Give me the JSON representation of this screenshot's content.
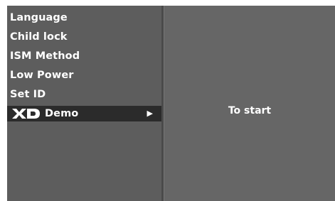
{
  "menu": {
    "items": [
      {
        "label": "Language"
      },
      {
        "label": "Child lock"
      },
      {
        "label": "ISM Method"
      },
      {
        "label": "Low Power"
      },
      {
        "label": "Set ID"
      }
    ],
    "selected": {
      "logo_text": "XD",
      "label": "Demo",
      "arrow": "▶",
      "icon": "xd-logo-icon"
    }
  },
  "detail": {
    "action_label": "To start"
  },
  "colors": {
    "panel_bg": "#5d5d5d",
    "right_bg": "#666666",
    "selected_bg": "#2b2b2b",
    "text": "#ffffff"
  }
}
